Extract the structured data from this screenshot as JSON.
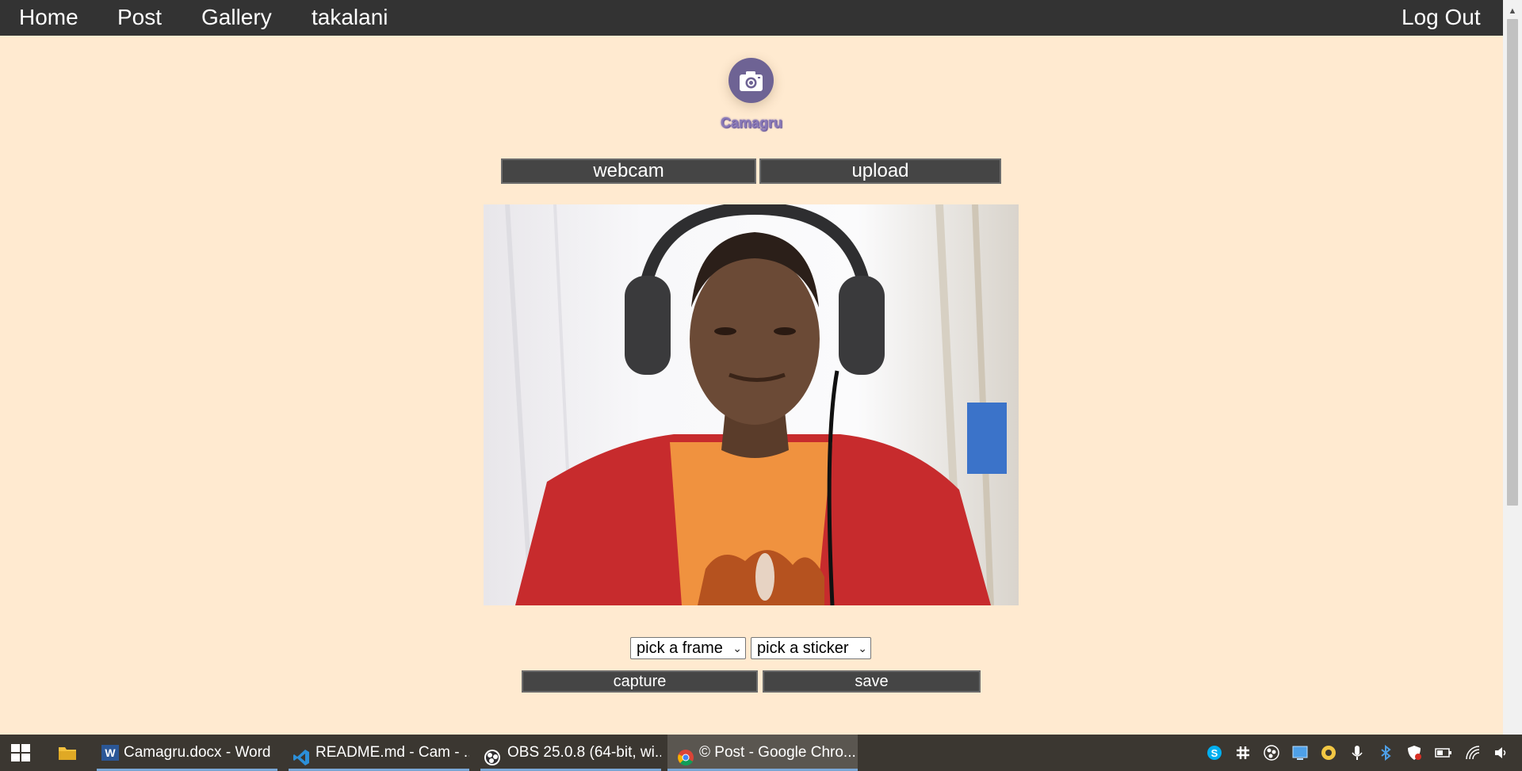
{
  "nav": {
    "links": [
      "Home",
      "Post",
      "Gallery",
      "takalani"
    ],
    "logout": "Log Out"
  },
  "brand": {
    "title": "Camagru",
    "icon": "camera-icon"
  },
  "mode_buttons": {
    "webcam": "webcam",
    "upload": "upload"
  },
  "selects": {
    "frame": "pick a frame",
    "sticker": "pick a sticker"
  },
  "actions": {
    "capture": "capture",
    "save": "save"
  },
  "taskbar": {
    "items": [
      {
        "label": "Camagru.docx - Word",
        "icon": "word-icon"
      },
      {
        "label": "README.md - Cam - ...",
        "icon": "vscode-icon"
      },
      {
        "label": "OBS 25.0.8 (64-bit, wi...",
        "icon": "obs-icon"
      },
      {
        "label": "© Post - Google Chro...",
        "icon": "chrome-icon"
      }
    ],
    "tray_icons": [
      "skype-icon",
      "slack-icon",
      "obs-tray-icon",
      "display-icon",
      "security-icon",
      "microphone-icon",
      "bluetooth-icon",
      "defender-icon",
      "battery-icon",
      "wifi-icon",
      "volume-icon"
    ]
  },
  "colors": {
    "background": "#ffead0",
    "nav": "#333333",
    "button": "#454545",
    "brand": "#8a7ab8"
  }
}
